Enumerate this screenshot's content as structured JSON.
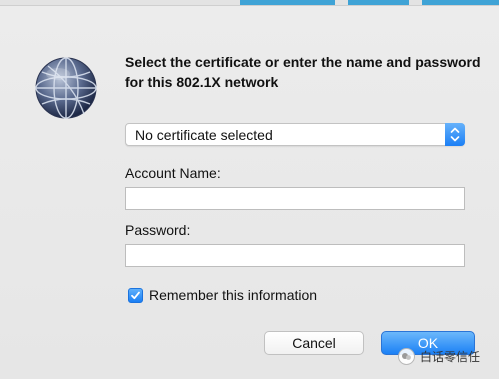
{
  "dialog": {
    "heading": "Select the certificate or enter the name and password for this 802.1X network",
    "certificate_select": {
      "selected": "No certificate selected"
    },
    "account_name": {
      "label": "Account Name:",
      "value": ""
    },
    "password": {
      "label": "Password:",
      "value": ""
    },
    "remember": {
      "label": "Remember this information",
      "checked": true
    },
    "buttons": {
      "cancel": "Cancel",
      "ok": "OK"
    }
  },
  "watermark": {
    "text": "白话零信任"
  },
  "icons": {
    "dialog_icon": "network-globe-icon",
    "stepper": "chevron-up-down-icon",
    "checkmark": "checkmark-icon"
  },
  "colors": {
    "accent": "#1b80f5",
    "background": "#ececec",
    "tab_blue": "#3fa3d6"
  }
}
